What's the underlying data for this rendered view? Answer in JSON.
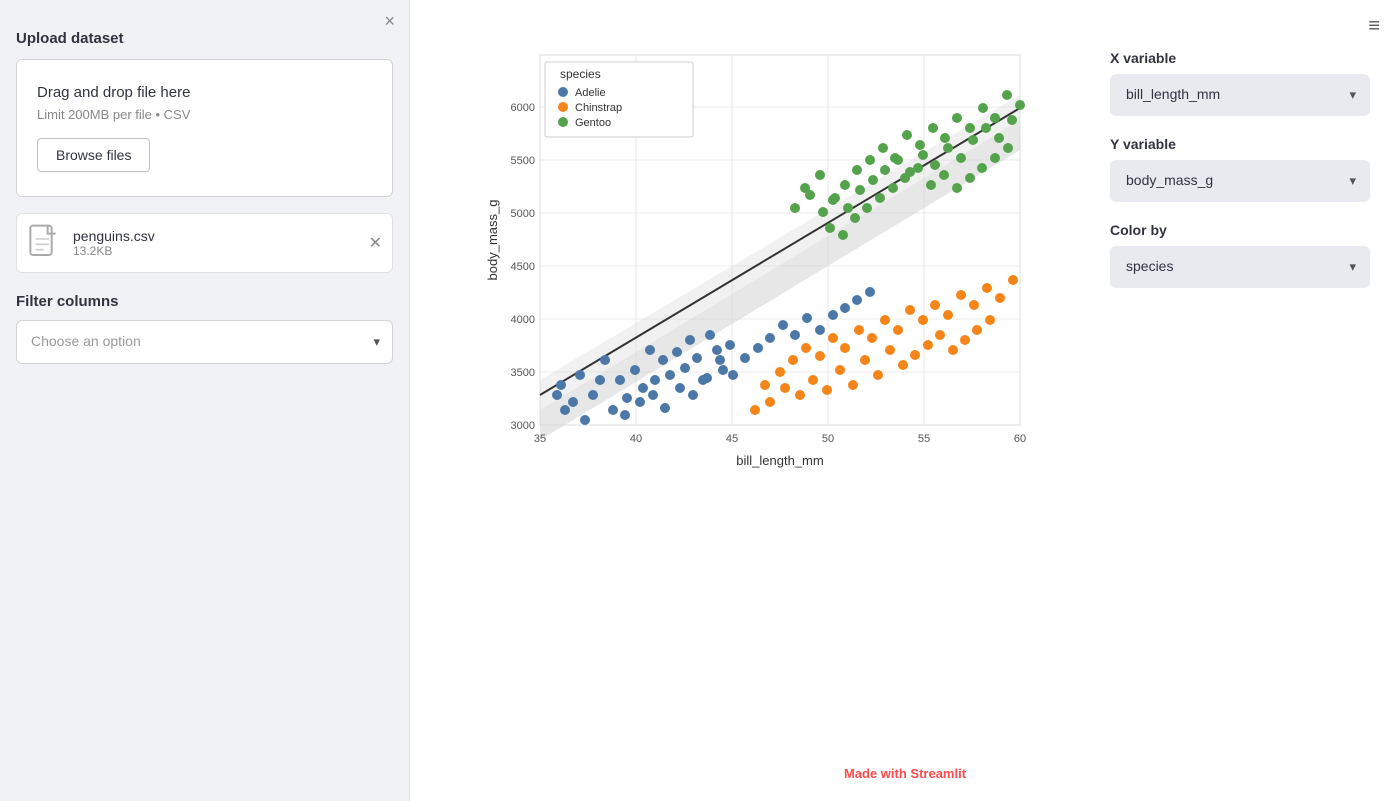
{
  "sidebar": {
    "close_icon": "×",
    "upload_label": "Upload dataset",
    "drag_title": "Drag and drop file here",
    "drag_subtitle": "Limit 200MB per file • CSV",
    "browse_btn": "Browse files",
    "file": {
      "name": "penguins.csv",
      "size": "13.2KB"
    },
    "filter_label": "Filter columns",
    "filter_placeholder": "Choose an option"
  },
  "controls": {
    "x_label": "X variable",
    "x_value": "bill_length_mm",
    "y_label": "Y variable",
    "y_value": "body_mass_g",
    "color_label": "Color by",
    "color_value": "species"
  },
  "chart": {
    "x_axis_label": "bill_length_mm",
    "y_axis_label": "body_mass_g",
    "legend_title": "species",
    "legend_items": [
      {
        "label": "Adelie",
        "color": "#4c78a8"
      },
      {
        "label": "Chinstrap",
        "color": "#f58518"
      },
      {
        "label": "Gentoo",
        "color": "#54a24b"
      }
    ],
    "x_ticks": [
      35,
      40,
      45,
      50,
      55,
      60
    ],
    "y_ticks": [
      3000,
      3500,
      4000,
      4500,
      5000,
      5500,
      6000
    ]
  },
  "footer": {
    "text_before": "Made with ",
    "brand": "Streamlit"
  },
  "hamburger_icon": "≡"
}
